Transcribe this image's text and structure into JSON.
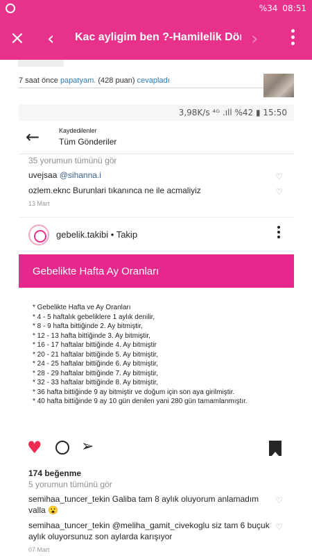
{
  "status_bar": {
    "battery": "%34",
    "time": "08:51"
  },
  "app_bar": {
    "close_icon": "×",
    "back_icon": "‹",
    "title": "Kac ayligim ben ?-Hamilelik Döne...",
    "forward_icon": "›"
  },
  "answer": {
    "time_ago": "7 saat önce",
    "user": "papatyam.",
    "points": "(428 puan)",
    "action": "cevapladı"
  },
  "screenshot": {
    "status": "3,98K/s  ⁴ᴳ .ıll %42 ▮ 15:50",
    "header": {
      "subtitle": "Kaydedilenler",
      "title": "Tüm Gönderiler"
    },
    "top_comments": {
      "view_all": "35 yorumun tümünü gör",
      "items": [
        {
          "user": "uvejsaa",
          "text": "@sihanna.i"
        },
        {
          "user": "ozlem.eknc",
          "text": "Burunlari tıkanınca ne ile acmaliyiz"
        }
      ],
      "date": "13 Mart"
    },
    "post": {
      "account": "gebelik.takibi • Takip",
      "banner_title": "Gebelikte Hafta Ay Oranları",
      "lines": [
        "* Gebelikte Hafta ve Ay Oranları",
        "* 4 - 5 haftalık gebeliklere 1 aylık denilir,",
        "* 8 - 9 hafta bittiğinde 2. Ay bitmiştir,",
        "* 12 - 13 hafta bittiğinde 3. Ay bitmiştir,",
        "* 16 - 17 haftalar bittiğinde 4. Ay bitmiştir",
        "* 20 - 21 haftalar bittiğinde 5. Ay bitmiştir,",
        "* 24 - 25 haftalar bittiğinde 6. Ay bitmiştir,",
        "* 28 - 29 haftalar bittiğinde 7. Ay bitmiştir,",
        "* 32 - 33 haftalar bittiğinde 8. Ay bitmiştir,",
        "* 36 hafta bittiğinde 9 ay bitmiştir ve doğum için son aya girilmiştir.",
        "* 40 hafta bittiğinde 9 ay 10 gün denilen yani 280 gün tamamlanmıştır."
      ],
      "likes": "174 beğenme"
    },
    "bottom_comments": {
      "view_all": "5 yorumun tümünü gör",
      "items": [
        {
          "user": "semihaa_tuncer_tekin",
          "text": "Galiba tam 8 aylık oluyorum anlamadım valla 😮"
        },
        {
          "user": "semihaa_tuncer_tekin",
          "text": "@meliha_gamit_civekoglu siz tam 6 buçuk aylık oluyorsunuz son aylarda karışıyor"
        }
      ],
      "date": "07 Mart"
    }
  }
}
